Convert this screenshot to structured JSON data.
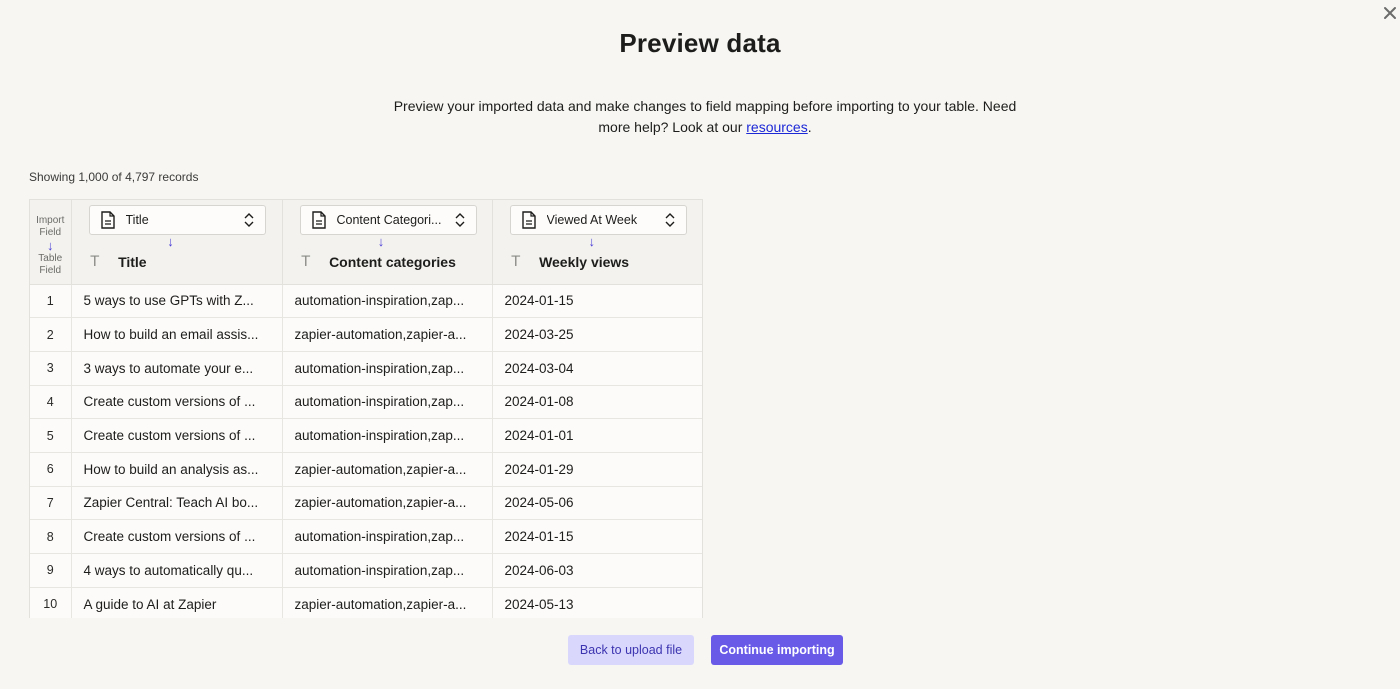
{
  "dialog": {
    "title": "Preview data",
    "description_before_link": "Preview your imported data and make changes to field mapping before importing to your table. Need more help? Look at our ",
    "link_text": "resources",
    "description_after_link": ".",
    "close_icon": "close-icon"
  },
  "records_status": "Showing 1,000 of 4,797 records",
  "table": {
    "mapping_header": {
      "import_label_1": "Import",
      "import_label_2": "Field",
      "arrow": "↓",
      "table_label_1": "Table",
      "table_label_2": "Field"
    },
    "columns": [
      {
        "import_field": "Title",
        "table_field": "Title",
        "field_icon": "text-type-icon",
        "select_icon": "document-icon"
      },
      {
        "import_field": "Content Categori...",
        "table_field": "Content categories",
        "field_icon": "text-type-icon",
        "select_icon": "document-icon"
      },
      {
        "import_field": "Viewed At Week",
        "table_field": "Weekly views",
        "field_icon": "text-type-icon",
        "select_icon": "document-icon"
      }
    ],
    "arrow_glyph": "↓",
    "type_glyph": "T",
    "rows": [
      {
        "n": "1",
        "title": "5 ways to use GPTs with Z...",
        "categories": "automation-inspiration,zap...",
        "week": "2024-01-15"
      },
      {
        "n": "2",
        "title": "How to build an email assis...",
        "categories": "zapier-automation,zapier-a...",
        "week": "2024-03-25"
      },
      {
        "n": "3",
        "title": "3 ways to automate your e...",
        "categories": "automation-inspiration,zap...",
        "week": "2024-03-04"
      },
      {
        "n": "4",
        "title": "Create custom versions of ...",
        "categories": "automation-inspiration,zap...",
        "week": "2024-01-08"
      },
      {
        "n": "5",
        "title": "Create custom versions of ...",
        "categories": "automation-inspiration,zap...",
        "week": "2024-01-01"
      },
      {
        "n": "6",
        "title": "How to build an analysis as...",
        "categories": "zapier-automation,zapier-a...",
        "week": "2024-01-29"
      },
      {
        "n": "7",
        "title": "Zapier Central: Teach AI bo...",
        "categories": "zapier-automation,zapier-a...",
        "week": "2024-05-06"
      },
      {
        "n": "8",
        "title": "Create custom versions of ...",
        "categories": "automation-inspiration,zap...",
        "week": "2024-01-15"
      },
      {
        "n": "9",
        "title": "4 ways to automatically qu...",
        "categories": "automation-inspiration,zap...",
        "week": "2024-06-03"
      },
      {
        "n": "10",
        "title": "A guide to AI at Zapier",
        "categories": "zapier-automation,zapier-a...",
        "week": "2024-05-13"
      }
    ]
  },
  "buttons": {
    "back": "Back to upload file",
    "continue": "Continue importing"
  },
  "colors": {
    "accent": "#695be8",
    "accent_light": "#d9d8fc",
    "link": "#1c28d6",
    "mapping_arrow": "#4b3fd6",
    "background": "#f7f6f3"
  }
}
